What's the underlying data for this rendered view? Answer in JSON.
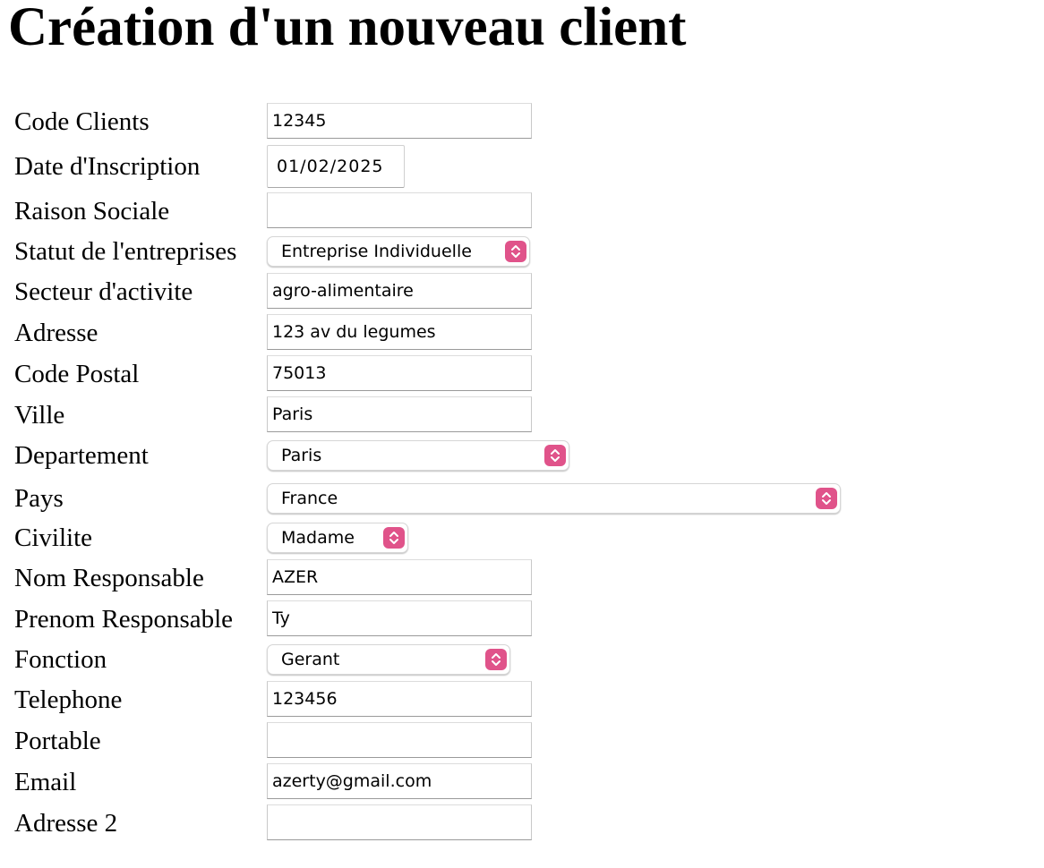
{
  "page": {
    "title": "Création d'un nouveau client"
  },
  "form": {
    "fields": [
      {
        "label": "Code Clients",
        "type": "text",
        "value": "12345"
      },
      {
        "label": "Date d'Inscription",
        "type": "date",
        "value": "01/02/2025"
      },
      {
        "label": "Raison Sociale",
        "type": "text",
        "value": ""
      },
      {
        "label": "Statut de l'entreprises",
        "type": "select",
        "value": "Entreprise Individuelle"
      },
      {
        "label": "Secteur d'activite",
        "type": "text",
        "value": "agro-alimentaire"
      },
      {
        "label": "Adresse",
        "type": "text",
        "value": "123 av du legumes"
      },
      {
        "label": "Code Postal",
        "type": "text",
        "value": "75013"
      },
      {
        "label": "Ville",
        "type": "text",
        "value": "Paris"
      },
      {
        "label": "Departement",
        "type": "select",
        "value": "Paris"
      },
      {
        "label": "Pays",
        "type": "select",
        "value": "France"
      },
      {
        "label": "Civilite",
        "type": "select",
        "value": "Madame"
      },
      {
        "label": "Nom Responsable",
        "type": "text",
        "value": "AZER"
      },
      {
        "label": "Prenom Responsable",
        "type": "text",
        "value": "Ty"
      },
      {
        "label": "Fonction",
        "type": "select",
        "value": "Gerant"
      },
      {
        "label": "Telephone",
        "type": "text",
        "value": "123456"
      },
      {
        "label": "Portable",
        "type": "text",
        "value": ""
      },
      {
        "label": "Email",
        "type": "text",
        "value": "azerty@gmail.com"
      },
      {
        "label": "Adresse 2",
        "type": "text",
        "value": ""
      }
    ]
  },
  "colors": {
    "select_accent": "#e0538a"
  },
  "icons": {
    "select_arrow": "chevron-up-down-icon"
  }
}
